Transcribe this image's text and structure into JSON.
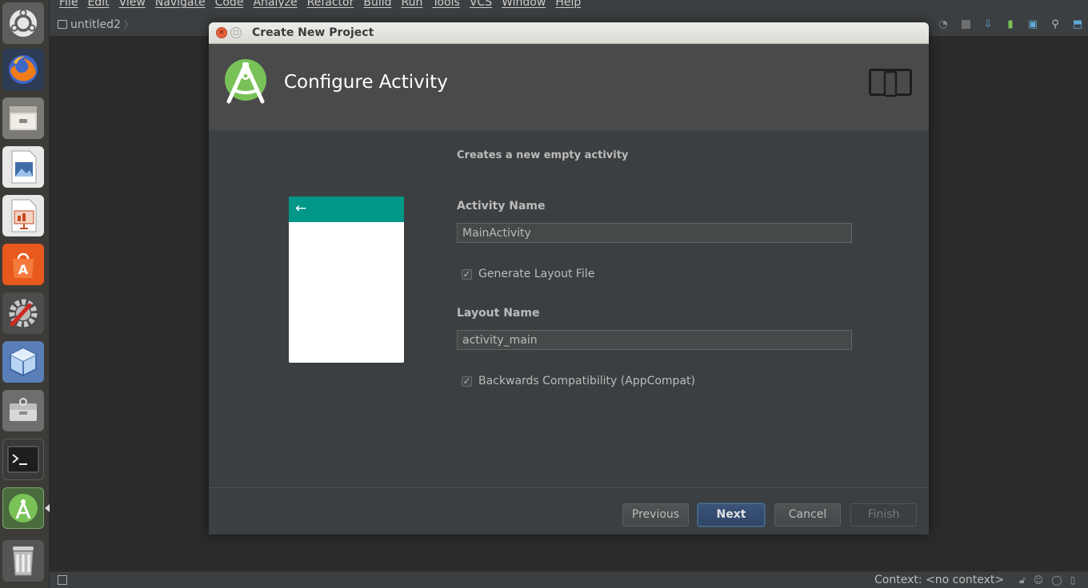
{
  "launcher": {
    "items": [
      {
        "name": "ubuntu-dash",
        "color": "#8e8e8e"
      },
      {
        "name": "firefox",
        "color": "#e66000"
      },
      {
        "name": "files",
        "color": "#9c9c94"
      },
      {
        "name": "libreoffice-draw",
        "color": "#3e6fa9"
      },
      {
        "name": "libreoffice-impress",
        "color": "#c84a1c"
      },
      {
        "name": "software-center",
        "color": "#e2591e"
      },
      {
        "name": "system-settings",
        "color": "#6f6f6f"
      },
      {
        "name": "virtualbox",
        "color": "#4f7ec7"
      },
      {
        "name": "archive-manager",
        "color": "#8d8d8d"
      },
      {
        "name": "terminal",
        "color": "#2b2b2b"
      },
      {
        "name": "android-studio",
        "color": "#78c257"
      },
      {
        "name": "trash",
        "color": "#7a7a7a"
      }
    ]
  },
  "menubar": {
    "items": [
      "File",
      "Edit",
      "View",
      "Navigate",
      "Code",
      "Analyze",
      "Refactor",
      "Build",
      "Run",
      "Tools",
      "VCS",
      "Window",
      "Help"
    ]
  },
  "toolbar": {
    "project_name": "untitled2",
    "separator": "〉"
  },
  "dialog": {
    "window_title": "Create New Project",
    "close_glyph": "×",
    "maximize_glyph": "□",
    "banner_title": "Configure Activity",
    "description": "Creates a new empty activity",
    "activity_name_label": "Activity Name",
    "activity_name_value": "MainActivity",
    "generate_layout_label": "Generate Layout File",
    "generate_layout_checked": true,
    "layout_name_label": "Layout Name",
    "layout_name_value": "activity_main",
    "backwards_compat_label": "Backwards Compatibility (AppCompat)",
    "backwards_compat_checked": true,
    "check_glyph": "✓",
    "preview_back_glyph": "←",
    "preview_toolbar_color": "#009688",
    "buttons": {
      "previous": "Previous",
      "next": "Next",
      "cancel": "Cancel",
      "finish": "Finish"
    }
  },
  "statusbar": {
    "context": "Context: <no context>"
  }
}
